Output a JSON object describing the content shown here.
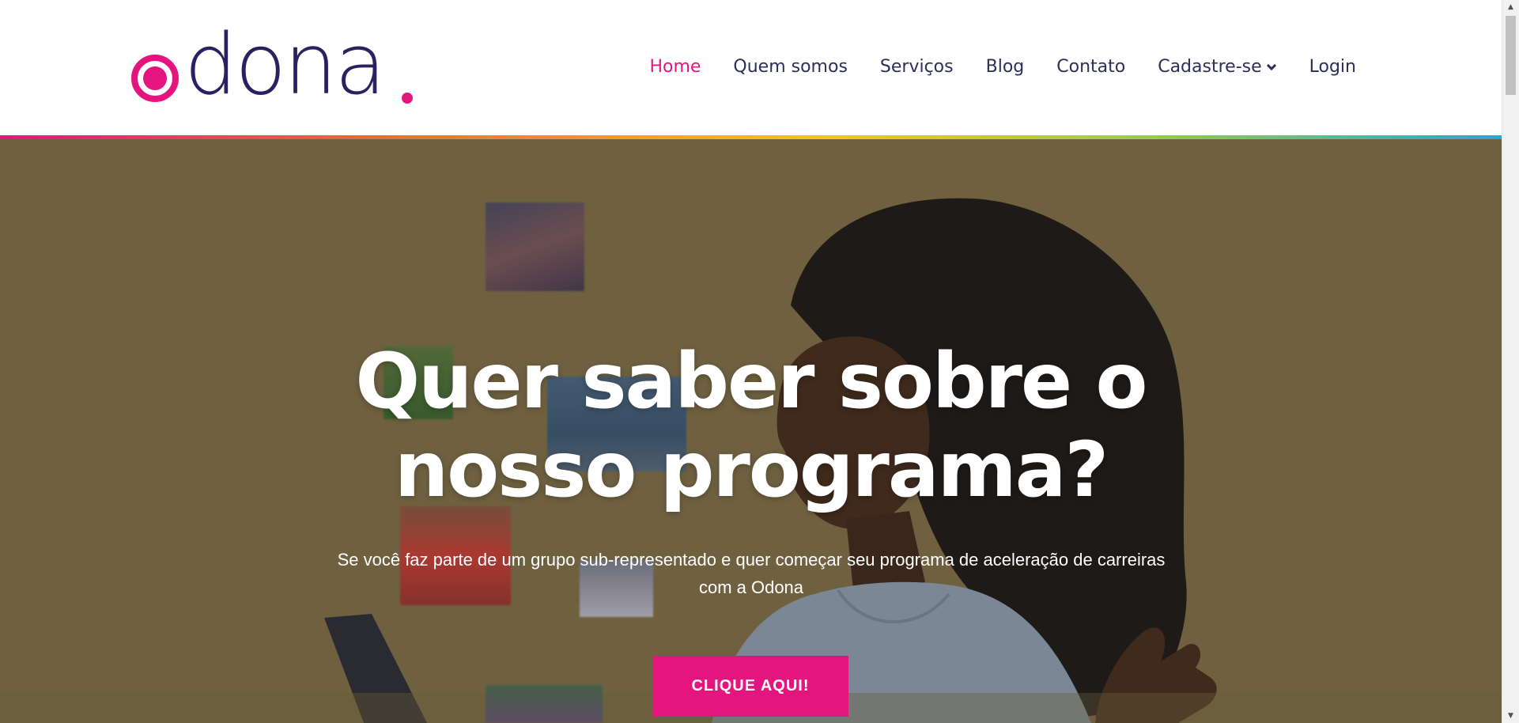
{
  "brand": {
    "logo_text": "dona",
    "accent_color": "#e5157f",
    "navy_color": "#2b2160"
  },
  "nav": {
    "items": [
      {
        "label": "Home",
        "active": true
      },
      {
        "label": "Quem somos",
        "active": false
      },
      {
        "label": "Serviços",
        "active": false
      },
      {
        "label": "Blog",
        "active": false
      },
      {
        "label": "Contato",
        "active": false
      },
      {
        "label": "Cadastre-se",
        "active": false,
        "has_dropdown": true
      },
      {
        "label": "Login",
        "active": false
      }
    ]
  },
  "hero": {
    "title_line1": "Quer saber sobre o",
    "title_line2": "nosso programa?",
    "subtitle_line1": "Se você faz parte de um grupo sub-representado e quer começar seu programa de aceleração de carreiras",
    "subtitle_line2": "com a Odona",
    "cta_label": "CLIQUE AQUI!",
    "background_color": "#6f6140"
  }
}
